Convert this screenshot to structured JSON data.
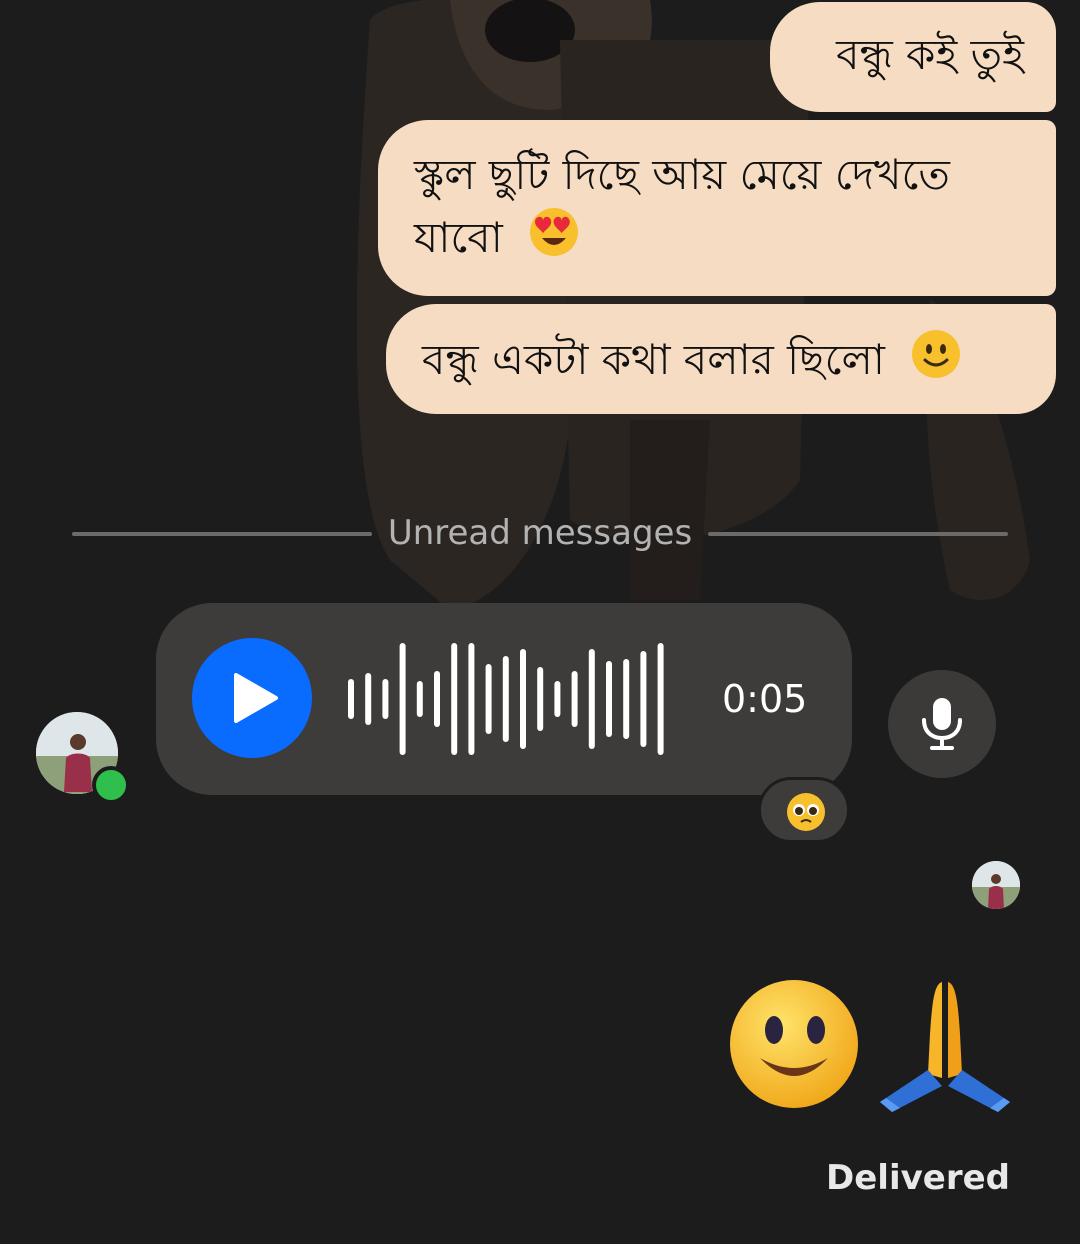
{
  "messages": [
    {
      "text": "বন্ধু কই তুই",
      "emoji": null
    },
    {
      "text": "স্কুল ছুটি দিছে আয় মেয়ে দেখতে যাবো",
      "emoji": "heart-eyes-emoji"
    },
    {
      "text": "বন্ধু একটা কথা বলার ছিলো",
      "emoji": "smiling-face-emoji"
    }
  ],
  "divider": {
    "label": "Unread messages"
  },
  "voice_message": {
    "duration": "0:05",
    "reaction": "pleading-face-emoji"
  },
  "sent_emojis": [
    "smiling-face-emoji",
    "folded-hands-emoji"
  ],
  "status": "Delivered",
  "colors": {
    "background": "#1c1c1d",
    "bubble": "#f6dcc3",
    "voice_bubble": "#3e3c3b",
    "play_button": "#0a6cff",
    "online": "#2fbf4d"
  }
}
